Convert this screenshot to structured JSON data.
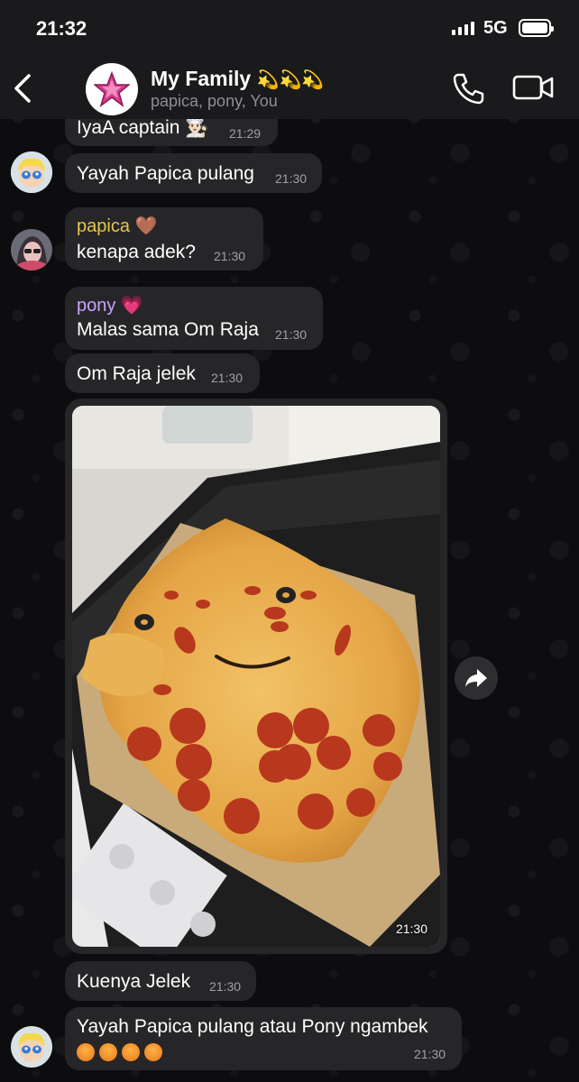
{
  "status_bar": {
    "time": "21:32",
    "network": "5G"
  },
  "header": {
    "title": "My Family",
    "title_emoji": "💫💫💫",
    "subtitle": "papica, pony, You"
  },
  "messages": {
    "m0": {
      "text": "IyaA captain 👨🏻‍🍳",
      "time": "21:29"
    },
    "m1": {
      "text": "Yayah Papica pulang",
      "time": "21:30"
    },
    "m2": {
      "sender": "papica 🤎",
      "text": "kenapa adek?",
      "time": "21:30"
    },
    "m3": {
      "sender": "pony 💗",
      "text": "Malas sama Om Raja",
      "time": "21:30"
    },
    "m4": {
      "text": "Om Raja jelek",
      "time": "21:30"
    },
    "m5": {
      "time": "21:30"
    },
    "m6": {
      "text": "Kuenya Jelek",
      "time": "21:30"
    },
    "m7": {
      "text": "Yayah Papica pulang atau Pony ngambek",
      "time": "21:30"
    }
  },
  "colors": {
    "papica_name": "#e6c54a",
    "pony_name": "#c7a3ff",
    "bubble": "#262628",
    "header": "#1a1a1c"
  }
}
